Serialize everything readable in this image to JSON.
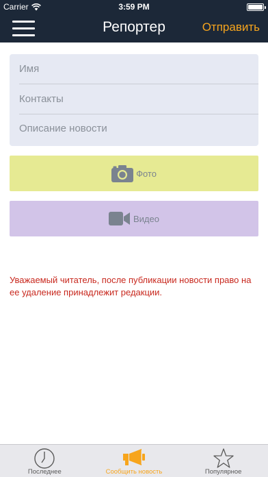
{
  "status_bar": {
    "carrier": "Carrier",
    "time": "3:59 PM"
  },
  "nav": {
    "title": "Репортер",
    "send_label": "Отправить"
  },
  "form": {
    "name_placeholder": "Имя",
    "contacts_placeholder": "Контакты",
    "description_placeholder": "Описание новости"
  },
  "media": {
    "photo_label": "Фото",
    "video_label": "Видео"
  },
  "notice": "Уважаемый читатель, после публикации новости право на ее удаление принадлежит редакции.",
  "tabs": [
    {
      "label": "Последнее",
      "icon": "clock-icon"
    },
    {
      "label": "Сообщить новость",
      "icon": "megaphone-icon",
      "active": true
    },
    {
      "label": "Популярное",
      "icon": "star-icon"
    }
  ],
  "colors": {
    "nav_background": "#1c2838",
    "accent": "#f7a51d",
    "photo_button": "#e6ea93",
    "video_button": "#d2c4e8",
    "notice_text": "#c8281e"
  }
}
